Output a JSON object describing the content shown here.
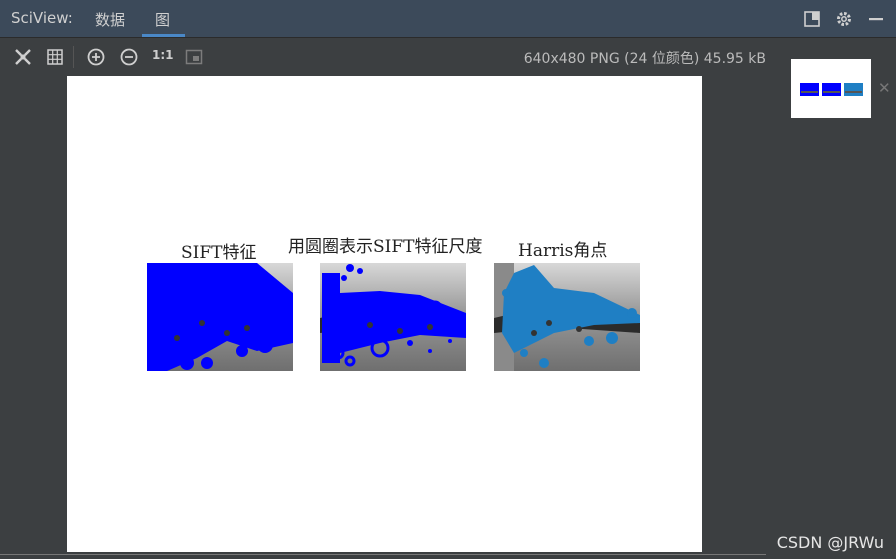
{
  "topbar": {
    "app_label": "SciView:",
    "tab_data": "数据",
    "tab_graph": "图"
  },
  "toolbar": {
    "icons": [
      "fit-screen-icon",
      "grid-icon",
      "zoom-in-icon",
      "zoom-out-icon",
      "actual-size-icon",
      "crop-icon"
    ],
    "actual_size_label": "1:1",
    "image_info": "640x480 PNG (24 位颜色) 45.95 kB"
  },
  "figure": {
    "panels": [
      {
        "title": "SIFT特征"
      },
      {
        "title": "用圆圈表示SIFT特征尺度"
      },
      {
        "title": "Harris角点"
      }
    ]
  },
  "watermark": "CSDN @JRWu",
  "colors": {
    "accent": "#4a88c7",
    "sift_marker": "#0000ff",
    "harris_marker": "#1f7fc4"
  }
}
